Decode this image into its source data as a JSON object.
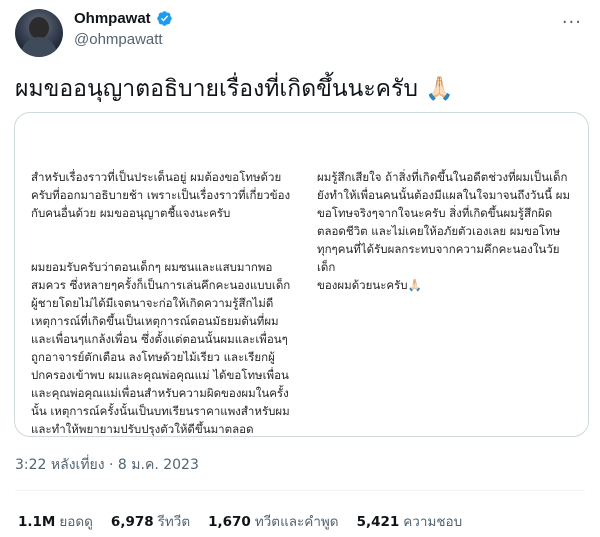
{
  "user": {
    "display_name": "Ohmpawat",
    "handle": "@ohmpawatt",
    "verified": true
  },
  "tweet": {
    "text": "ผมขออนุญาตอธิบายเรื่องที่เกิดขึ้นนะครับ 🙏🏻"
  },
  "image_card": {
    "left_paragraphs": [
      "สำหรับเรื่องราวที่เป็นประเด็นอยู่ ผมต้องขอโทษด้วย\nครับที่ออกมาอธิบายช้า เพราะเป็นเรื่องราวที่เกี่ยวข้อง\nกับคนอื่นด้วย ผมขออนุญาตชี้แจงนะครับ",
      "ผมยอมรับครับว่าตอนเด็กๆ ผมซนและแสบมากพอ\nสมควร ซึ่งหลายๆครั้งก็เป็นการเล่นคึกคะนองแบบเด็ก\nผู้ชายโดยไม่ได้มีเจตนาจะก่อให้เกิดความรู้สึกไม่ดี\nเหตุการณ์ที่เกิดขึ้นเป็นเหตุการณ์ตอนมัธยมต้นที่ผม\nและเพื่อนๆแกล้งเพื่อน ซึ่งตั้งแต่ตอนนั้นผมและเพื่อนๆ\nถูกอาจารย์ตักเตือน ลงโทษด้วยไม้เรียว และเรียกผู้\nปกครองเข้าพบ ผมและคุณพ่อคุณแม่ ได้ขอโทษเพื่อน\nและคุณพ่อคุณแม่เพื่อนสำหรับความผิดของผมในครั้ง\nนั้น เหตุการณ์ครั้งนั้นเป็นบทเรียนราคาแพงสำหรับผม\nและทำให้พยายามปรับปรุงตัวให้ดีขึ้นมาตลอด"
    ],
    "right_paragraphs": [
      "ผมรู้สึกเสียใจ ถ้าสิ่งที่เกิดขึ้นในอดีตช่วงที่ผมเป็นเด็ก\nยังทำให้เพื่อนคนนั้นต้องมีแผลในใจมาจนถึงวันนี้ ผม\nขอโทษจริงๆจากใจนะครับ สิ่งที่เกิดขึ้นผมรู้สึกผิด\nตลอดชีวิต และไม่เคยให้อภัยตัวเองเลย ผมขอโทษ\nทุกๆคนที่ได้รับผลกระทบจากความคึกคะนองในวัยเด็ก\nของผมด้วยนะครับ🙏🏻"
    ]
  },
  "timestamp": "3:22 หลังเที่ยง · 8 ม.ค. 2023",
  "stats": [
    {
      "count": "1.1M",
      "label": "ยอดดู"
    },
    {
      "count": "6,978",
      "label": "รีทวีต"
    },
    {
      "count": "1,670",
      "label": "ทวีตและคำพูด"
    },
    {
      "count": "5,421",
      "label": "ความชอบ"
    }
  ],
  "colors": {
    "verified_blue": "#1d9bf0",
    "secondary_text": "#536471",
    "border": "#cfd9de"
  },
  "icons": {
    "more": "more-horizontal-icon",
    "verified": "verified-badge-icon"
  }
}
